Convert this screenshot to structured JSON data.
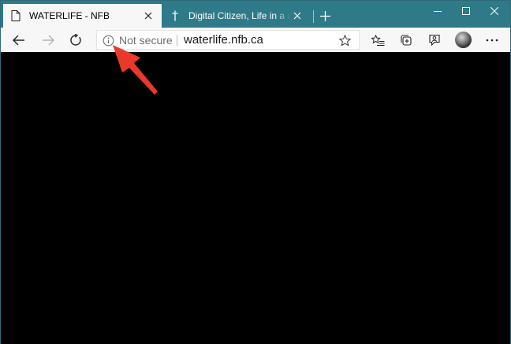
{
  "tabs": [
    {
      "title": "WATERLIFE - NFB",
      "icon": "page-icon",
      "active": true
    },
    {
      "title": "Digital Citizen, Life in a digital wo",
      "icon": "digital-citizen-favicon",
      "active": false
    }
  ],
  "window_controls": [
    "minimize-icon",
    "maximize-icon",
    "close-icon"
  ],
  "toolbar": {
    "back_icon": "back-arrow-icon",
    "forward_icon": "forward-arrow-icon",
    "refresh_icon": "refresh-icon",
    "right_icons": [
      "favorites-list-icon",
      "collections-icon",
      "read-aloud-icon",
      "profile-avatar",
      "more-icon"
    ]
  },
  "address_bar": {
    "security_icon": "info-icon",
    "security_label": "Not secure",
    "url": "waterlife.nfb.ca",
    "favorite_icon": "star-icon"
  },
  "colors": {
    "titlebar": "#2e7a89",
    "toolbar": "#f7f7f7",
    "content": "#000000",
    "annotation_arrow": "#e8392b"
  }
}
